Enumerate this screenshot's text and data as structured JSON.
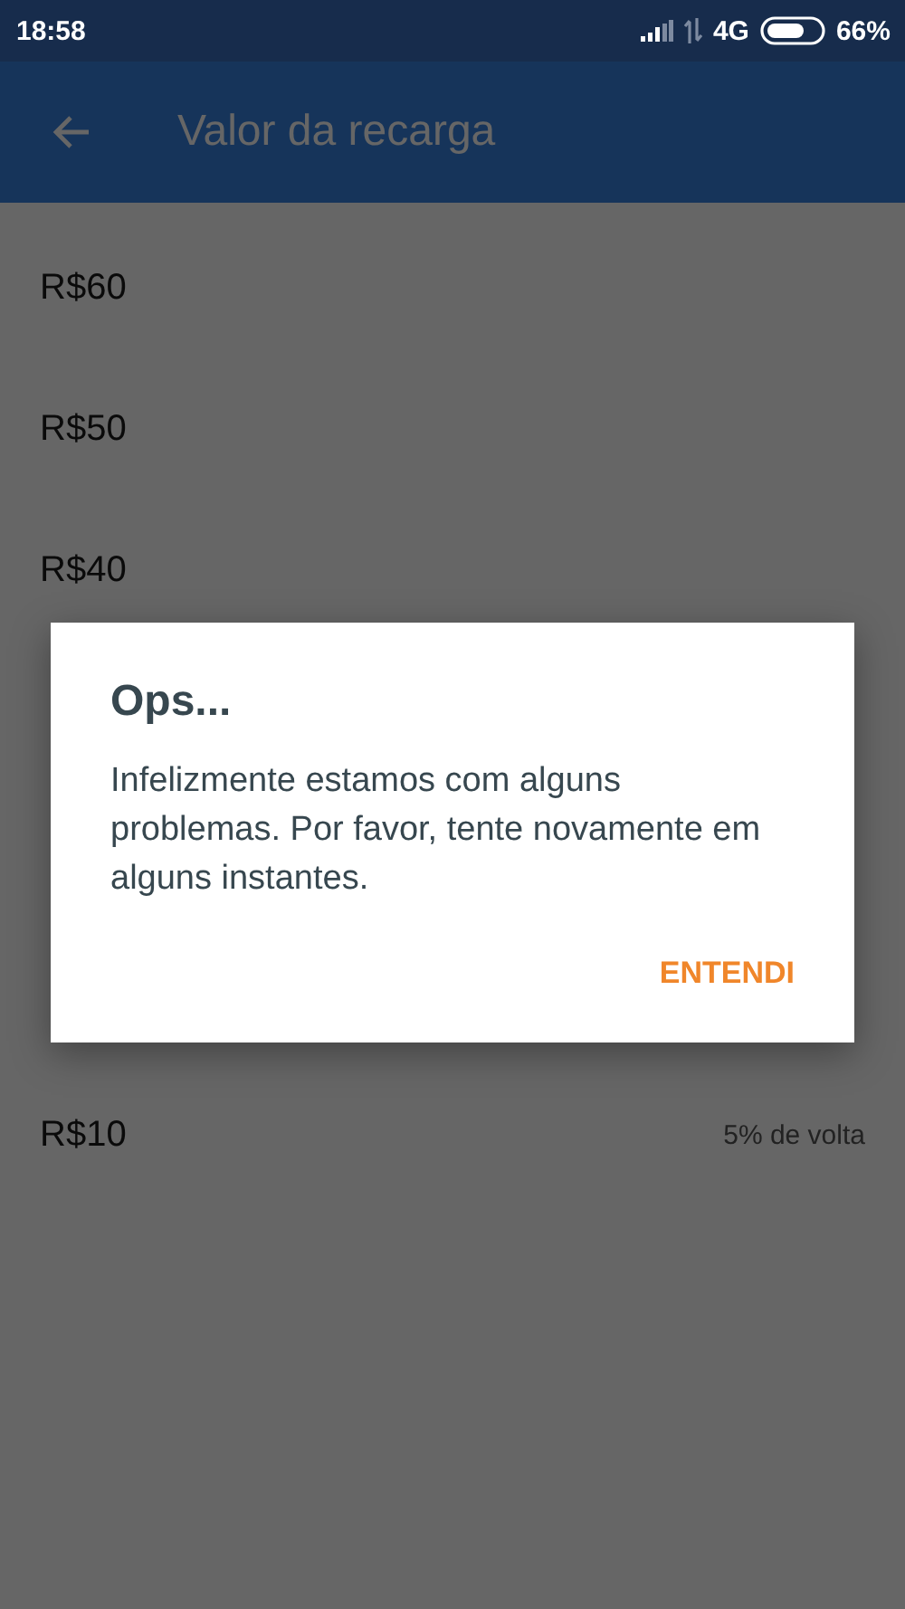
{
  "status_bar": {
    "time": "18:58",
    "network": "4G",
    "battery": "66%"
  },
  "app_bar": {
    "title": "Valor da recarga"
  },
  "options": [
    {
      "kind": "amount",
      "label": "R$60"
    },
    {
      "kind": "amount",
      "label": "R$50"
    },
    {
      "kind": "amount",
      "label": "R$40"
    },
    {
      "kind": "covered"
    },
    {
      "kind": "covered"
    },
    {
      "kind": "covered"
    },
    {
      "kind": "amount",
      "label": "R$10",
      "cashback": "5% de volta"
    }
  ],
  "dialog": {
    "title": "Ops...",
    "message": "Infelizmente estamos com alguns problemas. Por favor, tente novamente em alguns instantes.",
    "button": "ENTENDI"
  }
}
